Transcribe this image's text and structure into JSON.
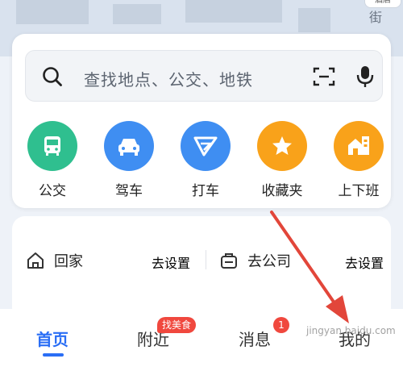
{
  "map": {
    "street": "街",
    "label": "酒店"
  },
  "search": {
    "placeholder": "查找地点、公交、地铁"
  },
  "quick_actions": [
    {
      "label": "公交",
      "color": "#2fbf8f",
      "icon": "bus-icon"
    },
    {
      "label": "驾车",
      "color": "#3f8ef2",
      "icon": "car-icon"
    },
    {
      "label": "打车",
      "color": "#3f8ef2",
      "icon": "taxi-icon"
    },
    {
      "label": "收藏夹",
      "color": "#f9a21a",
      "icon": "star-icon"
    },
    {
      "label": "上下班",
      "color": "#f9a21a",
      "icon": "commute-icon"
    }
  ],
  "places": {
    "home": {
      "label": "回家",
      "action": "去设置"
    },
    "work": {
      "label": "去公司",
      "action": "去设置"
    }
  },
  "tabs": [
    {
      "label": "首页",
      "active": true
    },
    {
      "label": "附近",
      "badge": "找美食"
    },
    {
      "label": "消息",
      "badge": "1"
    },
    {
      "label": "我的"
    }
  ],
  "watermark": "jingyan.baidu.com",
  "colors": {
    "accent": "#2a6ef5",
    "badge": "#f0483e",
    "annotation_arrow": "#e2463a"
  }
}
